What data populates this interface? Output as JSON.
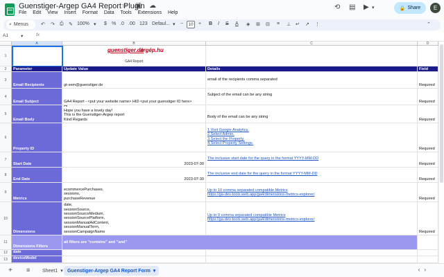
{
  "app": {
    "title": "Guenstiger-Argep GA4 Report Plugin",
    "title_icons": "☆ ▣ ☁",
    "menu": [
      "File",
      "Edit",
      "View",
      "Insert",
      "Format",
      "Data",
      "Tools",
      "Extensions",
      "Help"
    ],
    "share_label": "Share",
    "avatar_initial": "E"
  },
  "toolbar": {
    "menus_label": "Menus",
    "zoom": "100%",
    "currency": "$",
    "percent": "%",
    "decimals_dec": ".0",
    "decimals_inc": ".00",
    "number_format": "123",
    "font": "Defaul...",
    "font_size": "10"
  },
  "formula": {
    "cell_ref": "A1",
    "fx": "fx"
  },
  "columns": [
    "A",
    "B",
    "C",
    "D"
  ],
  "rows": [
    "1",
    "2",
    "3",
    "4",
    "5",
    "6",
    "7",
    "8",
    "9",
    "10",
    "11",
    "12",
    "13"
  ],
  "logo": {
    "brand1": "guenstiger.de",
    "brand2": "árgép.hu",
    "caption": "GA4 Report"
  },
  "header": {
    "param": "Parameter",
    "value": "Update Value",
    "details": "Details",
    "type": "Field Type"
  },
  "table": [
    {
      "param": "Email Recipients",
      "value": "gt-sem@guenstiger.de",
      "details": "email of the recipients comma separated",
      "type": "Required"
    },
    {
      "param": "Email Subject",
      "value": "GA4 Report - <put your website name> HID <put your guenstiger ID here>",
      "details": "Subject of the email can be any string",
      "type": "Required"
    },
    {
      "param": "Email Body",
      "value": "HI\nHope you have a lovely day!\nThis is the Guenstiger-Argep report\nKind Regards",
      "details": "Body of the email can be any string",
      "type": "Required"
    },
    {
      "param": "Property ID",
      "value": "",
      "details": "1.Visit Google Analytics.\n2.Select Admin.\n3.Select the Property.\n4.Select Property Settings.",
      "type": "Required"
    },
    {
      "param": "Start Date",
      "value": "2023-07-30",
      "details": "The inclusive start date for the query in the format YYYY-MM-DD",
      "type": "Required"
    },
    {
      "param": "End Date",
      "value": "2023-07-30",
      "details": "The inclusive end date for the query in the format YYYY-MM-DD",
      "type": "Required"
    },
    {
      "param": "Metrics",
      "value": "ecommercePurchases,\nsessions,\npurchaseRevenue",
      "details": "Up to 10 comma separated compatible Metrics\nhttps://ga-dev-tools.web.app/ga4/dimensions-metrics-explorer/",
      "type": "Required"
    },
    {
      "param": "Dimensions",
      "value": "date,\nsessionSource,\nsessionSourceMedium,\nsessionSourcePlatform,\nsessionManualAdContent,\nsessionManualTerm,\nsessionCampaignName",
      "details": "Up to 9 comma separated compatible Metrics\nhttps://ga-dev-tools.web.app/ga4/dimensions-metrics-explorer/",
      "type": "Required"
    }
  ],
  "filters": {
    "label": "Dimensions Filters",
    "note": "all filters are \"contains\" and \"and\""
  },
  "filter_rows": [
    {
      "param": "date"
    },
    {
      "param": "deviceModel"
    }
  ],
  "tabs": {
    "sheet1": "Sheet1",
    "form": "Guenstiger-Argep GA4 Report Form"
  }
}
